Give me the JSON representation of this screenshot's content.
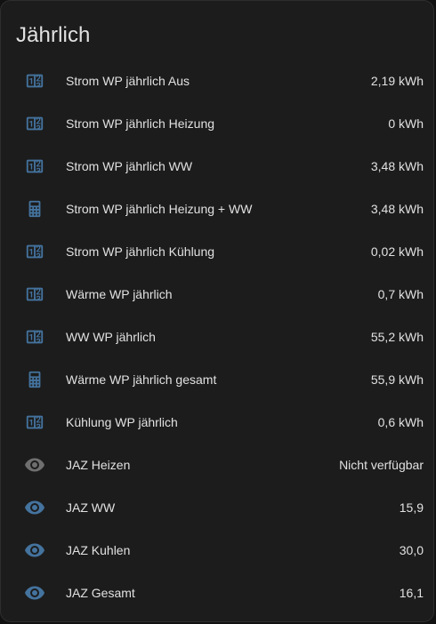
{
  "card": {
    "title": "Jährlich"
  },
  "colors": {
    "icon_active": "#44739e",
    "icon_inactive": "#6f6f6f"
  },
  "rows": [
    {
      "label": "Strom WP jährlich Aus",
      "value": "2,19 kWh",
      "icon": "counter-icon",
      "state": "active"
    },
    {
      "label": "Strom WP jährlich Heizung",
      "value": "0 kWh",
      "icon": "counter-icon",
      "state": "active"
    },
    {
      "label": "Strom WP jährlich WW",
      "value": "3,48 kWh",
      "icon": "counter-icon",
      "state": "active"
    },
    {
      "label": "Strom WP jährlich Heizung + WW",
      "value": "3,48 kWh",
      "icon": "calculator-icon",
      "state": "active"
    },
    {
      "label": "Strom WP jährlich Kühlung",
      "value": "0,02 kWh",
      "icon": "counter-icon",
      "state": "active"
    },
    {
      "label": "Wärme WP jährlich",
      "value": "0,7 kWh",
      "icon": "counter-icon",
      "state": "active"
    },
    {
      "label": "WW WP jährlich",
      "value": "55,2 kWh",
      "icon": "counter-icon",
      "state": "active"
    },
    {
      "label": "Wärme WP jährlich gesamt",
      "value": "55,9 kWh",
      "icon": "calculator-icon",
      "state": "active"
    },
    {
      "label": "Kühlung WP jährlich",
      "value": "0,6 kWh",
      "icon": "counter-icon",
      "state": "active"
    },
    {
      "label": "JAZ Heizen",
      "value": "Nicht verfügbar",
      "icon": "eye-icon",
      "state": "unavailable"
    },
    {
      "label": "JAZ WW",
      "value": "15,9",
      "icon": "eye-icon",
      "state": "active"
    },
    {
      "label": "JAZ Kuhlen",
      "value": "30,0",
      "icon": "eye-icon",
      "state": "active"
    },
    {
      "label": "JAZ Gesamt",
      "value": "16,1",
      "icon": "eye-icon",
      "state": "active"
    }
  ]
}
